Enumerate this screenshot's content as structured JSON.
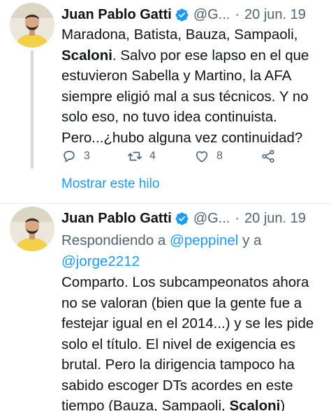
{
  "tweets": [
    {
      "author": {
        "name": "Juan Pablo Gatti",
        "handle": "@G...",
        "date": "20 jun. 19"
      },
      "text_lines": [
        {
          "parts": [
            {
              "t": "Maradona, Batista, Bauza, Sampaoli,"
            }
          ]
        },
        {
          "parts": [
            {
              "t": "Scaloni",
              "b": true
            },
            {
              "t": ". Salvo por ese lapso en el que"
            }
          ]
        },
        {
          "parts": [
            {
              "t": "estuvieron Sabella y Martino, la AFA"
            }
          ]
        },
        {
          "parts": [
            {
              "t": "siempre eligió mal a sus técnicos. Y no"
            }
          ]
        },
        {
          "parts": [
            {
              "t": "solo eso, no tuvo idea continuista."
            }
          ]
        },
        {
          "parts": [
            {
              "t": "Pero...¿hubo alguna vez continuidad?"
            }
          ]
        }
      ],
      "actions": {
        "replies": "3",
        "retweets": "4",
        "likes": "8"
      },
      "show_thread": "Mostrar este hilo"
    },
    {
      "author": {
        "name": "Juan Pablo Gatti",
        "handle": "@G...",
        "date": "20 jun. 19"
      },
      "reply_to": {
        "prefix": "Respondiendo a",
        "user1": "@peppinel",
        "joiner": "y a",
        "user2": "@jorge2212"
      },
      "text_lines": [
        {
          "parts": [
            {
              "t": "Comparto. Los subcampeonatos ahora"
            }
          ]
        },
        {
          "parts": [
            {
              "t": "no se valoran (bien que la gente fue a"
            }
          ]
        },
        {
          "parts": [
            {
              "t": "festejar igual en el 2014...) y se les pide"
            }
          ]
        },
        {
          "parts": [
            {
              "t": "solo el título. El nivel de exigencia es"
            }
          ]
        },
        {
          "parts": [
            {
              "t": "brutal. Pero la dirigencia tampoco ha"
            }
          ]
        },
        {
          "parts": [
            {
              "t": "sabido escoger DTs acordes en este"
            }
          ]
        },
        {
          "parts": [
            {
              "t": "tiempo (Bauza, Sampaoli, "
            },
            {
              "t": "Scaloni",
              "b": true
            },
            {
              "t": ")"
            }
          ]
        }
      ]
    }
  ],
  "colors": {
    "text": "#0f1419",
    "secondary": "#536471",
    "link": "#1d9bf0",
    "verified": "#1d9bf0",
    "avatar_shirt": "#f2d048"
  },
  "icons": {
    "verified": "verified-badge-icon",
    "reply": "reply-icon",
    "retweet": "retweet-icon",
    "like": "heart-icon",
    "share": "share-icon"
  }
}
